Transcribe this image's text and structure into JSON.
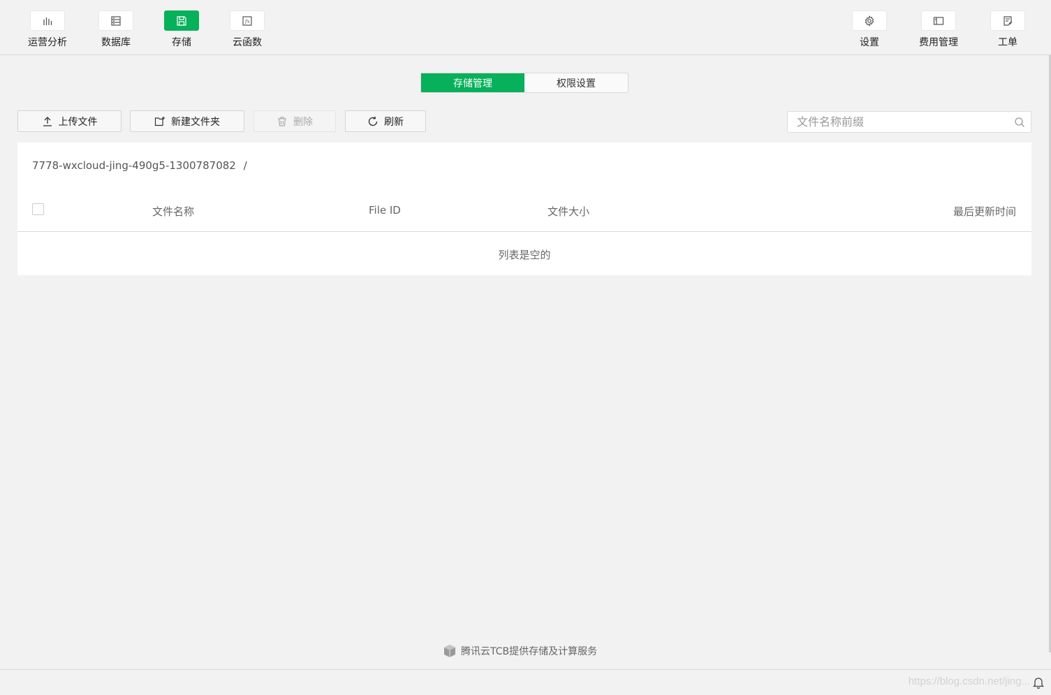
{
  "nav": {
    "left": [
      {
        "label": "运营分析",
        "icon": "bar-chart-icon"
      },
      {
        "label": "数据库",
        "icon": "database-icon"
      },
      {
        "label": "存储",
        "icon": "save-icon",
        "active": true
      },
      {
        "label": "云函数",
        "icon": "function-icon"
      }
    ],
    "right": [
      {
        "label": "设置",
        "icon": "gear-icon"
      },
      {
        "label": "费用管理",
        "icon": "billing-icon"
      },
      {
        "label": "工单",
        "icon": "ticket-icon"
      }
    ]
  },
  "tabs": [
    {
      "label": "存储管理",
      "active": true
    },
    {
      "label": "权限设置",
      "active": false
    }
  ],
  "toolbar": {
    "upload": "上传文件",
    "new_folder": "新建文件夹",
    "delete": "删除",
    "refresh": "刷新",
    "search_placeholder": "文件名称前缀"
  },
  "storage": {
    "bucket_path": "7778-wxcloud-jing-490g5-1300787082",
    "separator": "/",
    "columns": {
      "name": "文件名称",
      "file_id": "File ID",
      "size": "文件大小",
      "updated": "最后更新时间"
    },
    "empty_text": "列表是空的"
  },
  "footer": {
    "powered_by": "腾讯云TCB提供存储及计算服务",
    "watermark": "https://blog.csdn.net/jing..."
  },
  "colors": {
    "accent": "#07b05a",
    "background": "#f2f2f2"
  }
}
